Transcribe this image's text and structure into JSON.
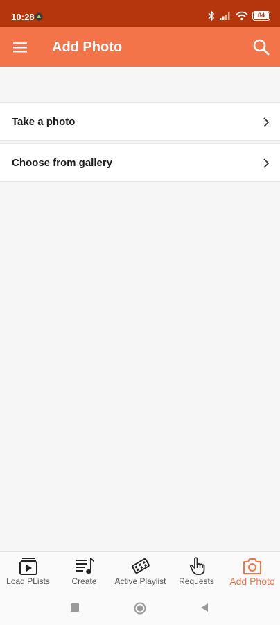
{
  "status_bar": {
    "time": "10:28",
    "battery": "84"
  },
  "app_bar": {
    "title": "Add Photo",
    "menu_icon": "hamburger-menu-icon",
    "search_icon": "search-icon"
  },
  "options": [
    {
      "label": "Take a photo",
      "icon": "chevron-right-icon"
    },
    {
      "label": "Choose from gallery",
      "icon": "chevron-right-icon"
    }
  ],
  "bottom_nav": {
    "active_index": 4,
    "active_color": "#f4744a",
    "items": [
      {
        "label": "Load PLists",
        "icon": "playlist-play-icon"
      },
      {
        "label": "Create",
        "icon": "music-list-icon"
      },
      {
        "label": "Active Playlist",
        "icon": "film-reel-icon"
      },
      {
        "label": "Requests",
        "icon": "hand-pointer-icon"
      },
      {
        "label": "Add Photo",
        "icon": "camera-icon"
      }
    ]
  },
  "colors": {
    "status_bar": "#b5350c",
    "app_bar": "#f4744a",
    "background": "#f6f6f6"
  }
}
